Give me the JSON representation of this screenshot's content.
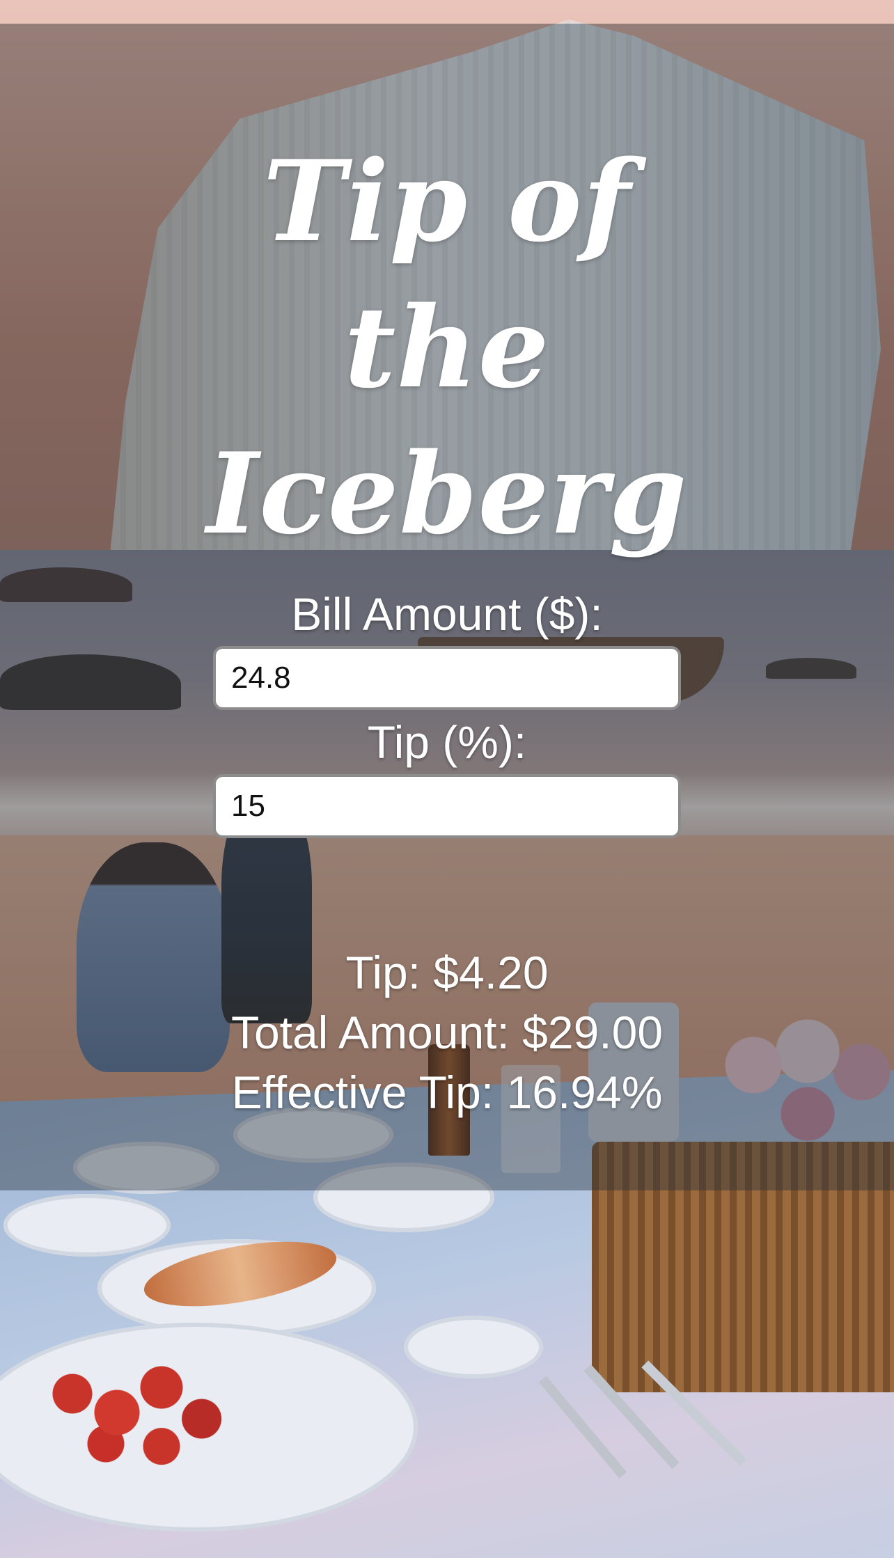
{
  "app": {
    "title": "Tip of the Iceberg"
  },
  "form": {
    "bill_label": "Bill Amount ($):",
    "bill_value": "24.8",
    "tip_label": "Tip (%):",
    "tip_value": "15"
  },
  "results": {
    "tip": "Tip: $4.20",
    "total": "Total Amount: $29.00",
    "effective_tip": "Effective Tip: 16.94%"
  },
  "colors": {
    "overlay": "#28323c",
    "text": "#ffffff",
    "input_border": "#8c8c8c"
  },
  "background": {
    "icon": "iceberg-beach-picnic-illustration"
  }
}
